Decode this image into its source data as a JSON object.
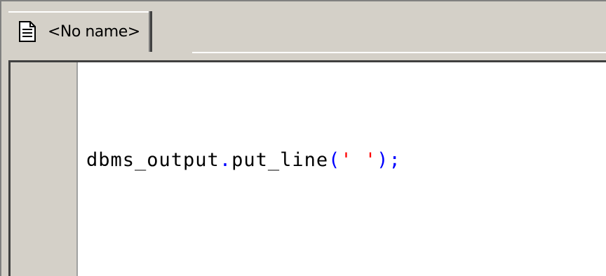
{
  "tab": {
    "icon": "document-icon",
    "label": "<No name>"
  },
  "editor": {
    "tokens": {
      "ident1": "dbms_output",
      "dot": ".",
      "ident2": "put_line",
      "lparen": "(",
      "string": "' '",
      "rparen": ")",
      "semicolon": ";"
    }
  },
  "colors": {
    "identifier": "#000000",
    "punctuation": "#0000ff",
    "string": "#ff0000",
    "gutter": "#d4d0c8",
    "editor_background": "#ffffff"
  }
}
